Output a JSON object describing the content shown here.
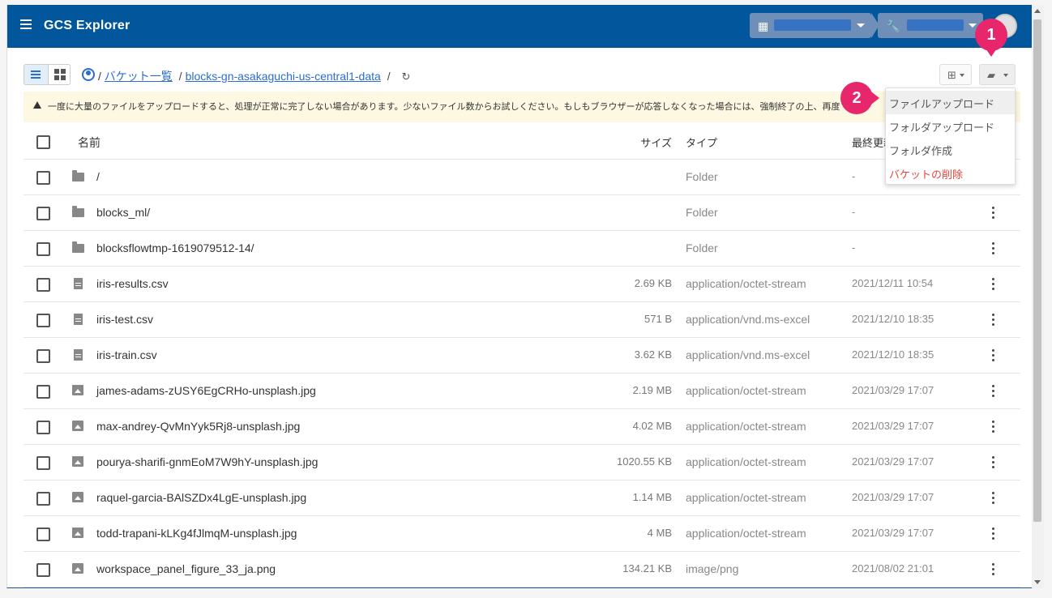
{
  "app": {
    "title": "GCS Explorer"
  },
  "breadcrumb": {
    "root_sep": "/",
    "buckets_link": "バケット一覧",
    "sep": "/",
    "bucket_link": "blocks-gn-asakaguchi-us-central1-data",
    "trailing_sep": "/"
  },
  "warning": {
    "text": "一度に大量のファイルをアップロードすると、処理が正常に完了しない場合があります。少ないファイル数からお試しください。もしもブラウザーが応答しなくなった場合には、強制終了の上、再度"
  },
  "table": {
    "headers": {
      "name": "名前",
      "size": "サイズ",
      "type": "タイプ",
      "modified": "最終更新"
    },
    "rows": [
      {
        "kind": "folder",
        "name": "/",
        "size": "",
        "type": "Folder",
        "modified": "-",
        "has_menu": false
      },
      {
        "kind": "folder",
        "name": "blocks_ml/",
        "size": "",
        "type": "Folder",
        "modified": "-",
        "has_menu": true
      },
      {
        "kind": "folder",
        "name": "blocksflowtmp-1619079512-14/",
        "size": "",
        "type": "Folder",
        "modified": "-",
        "has_menu": true
      },
      {
        "kind": "file",
        "name": "iris-results.csv",
        "size": "2.69 KB",
        "type": "application/octet-stream",
        "modified": "2021/12/11 10:54",
        "has_menu": true
      },
      {
        "kind": "file",
        "name": "iris-test.csv",
        "size": "571 B",
        "type": "application/vnd.ms-excel",
        "modified": "2021/12/10 18:35",
        "has_menu": true
      },
      {
        "kind": "file",
        "name": "iris-train.csv",
        "size": "3.62 KB",
        "type": "application/vnd.ms-excel",
        "modified": "2021/12/10 18:35",
        "has_menu": true
      },
      {
        "kind": "image",
        "name": "james-adams-zUSY6EgCRHo-unsplash.jpg",
        "size": "2.19 MB",
        "type": "application/octet-stream",
        "modified": "2021/03/29 17:07",
        "has_menu": true
      },
      {
        "kind": "image",
        "name": "max-andrey-QvMnYyk5Rj8-unsplash.jpg",
        "size": "4.02 MB",
        "type": "application/octet-stream",
        "modified": "2021/03/29 17:07",
        "has_menu": true
      },
      {
        "kind": "image",
        "name": "pourya-sharifi-gnmEoM7W9hY-unsplash.jpg",
        "size": "1020.55 KB",
        "type": "application/octet-stream",
        "modified": "2021/03/29 17:07",
        "has_menu": true
      },
      {
        "kind": "image",
        "name": "raquel-garcia-BAlSZDx4LgE-unsplash.jpg",
        "size": "1.14 MB",
        "type": "application/octet-stream",
        "modified": "2021/03/29 17:07",
        "has_menu": true
      },
      {
        "kind": "image",
        "name": "todd-trapani-kLKg4fJlmqM-unsplash.jpg",
        "size": "4 MB",
        "type": "application/octet-stream",
        "modified": "2021/03/29 17:07",
        "has_menu": true
      },
      {
        "kind": "image",
        "name": "workspace_panel_figure_33_ja.png",
        "size": "134.21 KB",
        "type": "image/png",
        "modified": "2021/08/02 21:01",
        "has_menu": true
      }
    ]
  },
  "actions_menu": {
    "items": [
      {
        "label": "ファイルアップロード",
        "active": true,
        "danger": false
      },
      {
        "label": "フォルダアップロード",
        "active": false,
        "danger": false
      },
      {
        "label": "フォルダ作成",
        "active": false,
        "danger": false
      },
      {
        "label": "バケットの削除",
        "active": false,
        "danger": true
      }
    ]
  },
  "callouts": {
    "first": "1",
    "second": "2"
  },
  "colors": {
    "appbar": "#02569b",
    "link": "#2a6dd1",
    "callout": "#e8266b",
    "danger": "#e8443a",
    "warning_bg": "#fdf8e1"
  },
  "icons": {
    "menu": "hamburger-icon",
    "org": "building-icon",
    "project": "wrench-icon",
    "account": "account-circle-icon",
    "refresh": "refresh-icon",
    "columns": "table-columns-icon",
    "actions": "folder-settings-icon",
    "folder": "folder-icon",
    "file": "file-icon",
    "image": "image-icon",
    "row_menu": "more-vertical-icon"
  }
}
